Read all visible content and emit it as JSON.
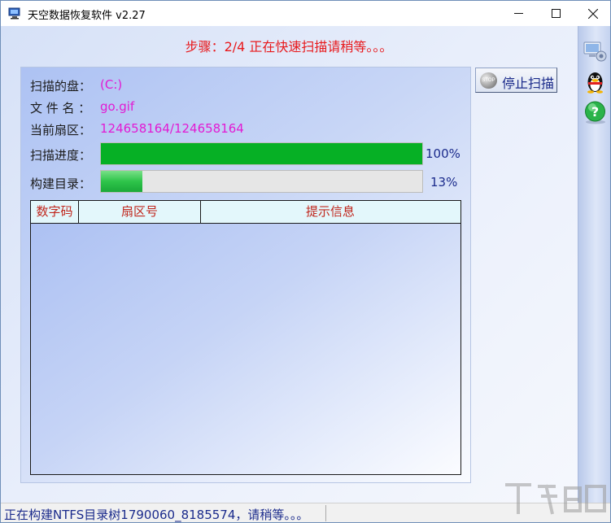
{
  "window": {
    "title": "天空数据恢复软件 v2.27",
    "controls": {
      "minimize": "—",
      "maximize": "☐",
      "close": "✕"
    }
  },
  "step": "步骤：2/4 正在快速扫描请稍等。。。",
  "scan": {
    "disk_label": "扫描的盘：",
    "disk_value": "(C:)",
    "file_label": "文 件 名 ：",
    "file_value": "go.gif",
    "sector_label": "当前扇区：",
    "sector_value": "124658164/124658164",
    "progress_label": "扫描进度：",
    "progress_percent": 100,
    "progress_text": "100%",
    "directory_label": "构建目录：",
    "directory_percent": 13,
    "directory_text": "13%"
  },
  "table": {
    "columns": [
      "数字码",
      "扇区号",
      "提示信息"
    ],
    "rows": []
  },
  "stop_button": {
    "label": "停止扫描",
    "icon": "stop-disc-icon",
    "icon_text": "STOP"
  },
  "side_toolbar": [
    {
      "icon": "settings-computer-icon"
    },
    {
      "icon": "qq-penguin-icon"
    },
    {
      "icon": "help-icon"
    }
  ],
  "status": "正在构建NTFS目录树1790060_8185574，请稍等。。。",
  "colors": {
    "step_text": "#e8191c",
    "value_text": "#e21ad3",
    "progress_green": "#06b025",
    "header_text": "#c0261c",
    "status_text": "#1b2b8c"
  }
}
